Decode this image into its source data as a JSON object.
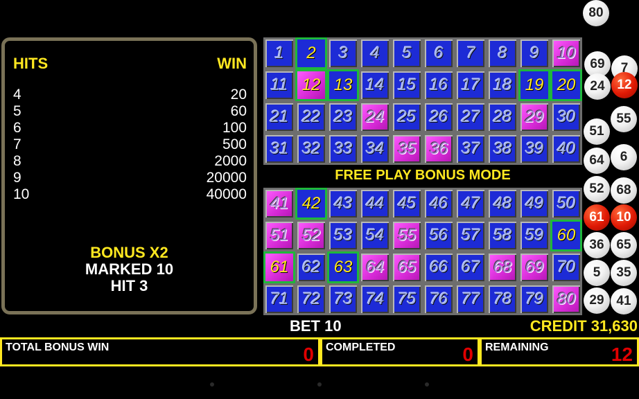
{
  "paytable": {
    "hits_label": "HITS",
    "win_label": "WIN",
    "rows": [
      {
        "hits": "4",
        "win": "20"
      },
      {
        "hits": "5",
        "win": "60"
      },
      {
        "hits": "6",
        "win": "100"
      },
      {
        "hits": "7",
        "win": "500"
      },
      {
        "hits": "8",
        "win": "2000"
      },
      {
        "hits": "9",
        "win": "20000"
      },
      {
        "hits": "10",
        "win": "40000"
      }
    ],
    "bonus": "BONUS X2",
    "marked": "MARKED 10",
    "hit": "HIT 3"
  },
  "mode_label": "FREE PLAY BONUS MODE",
  "board": {
    "drawn": [
      10,
      12,
      24,
      29,
      35,
      36,
      41,
      51,
      52,
      55,
      61,
      64,
      65,
      68,
      69,
      80
    ],
    "marked": [
      2,
      12,
      13,
      19,
      20,
      42,
      60,
      61,
      63
    ]
  },
  "balls": [
    {
      "n": "80",
      "red": false
    },
    {
      "n": "69",
      "red": false
    },
    {
      "n": "7",
      "red": false
    },
    {
      "n": "24",
      "red": false
    },
    {
      "n": "12",
      "red": true
    },
    {
      "n": "55",
      "red": false
    },
    {
      "n": "51",
      "red": false
    },
    {
      "n": "64",
      "red": false
    },
    {
      "n": "6",
      "red": false
    },
    {
      "n": "52",
      "red": false
    },
    {
      "n": "68",
      "red": false
    },
    {
      "n": "61",
      "red": true
    },
    {
      "n": "10",
      "red": true
    },
    {
      "n": "36",
      "red": false
    },
    {
      "n": "65",
      "red": false
    },
    {
      "n": "5",
      "red": false
    },
    {
      "n": "35",
      "red": false
    },
    {
      "n": "29",
      "red": false
    },
    {
      "n": "41",
      "red": false
    }
  ],
  "status": {
    "bet": "BET 10",
    "credit": "CREDIT 31,630",
    "total_bonus_win_label": "TOTAL BONUS WIN",
    "total_bonus_win_value": "0",
    "completed_label": "COMPLETED",
    "completed_value": "0",
    "remaining_label": "REMAINING",
    "remaining_value": "12"
  },
  "colors": {
    "cell_blue": "#1d2bd6",
    "cell_pink": "#d62ad6",
    "mark_border": "#1fb83b",
    "accent_yellow": "#ffe820",
    "value_red": "#e00000"
  }
}
